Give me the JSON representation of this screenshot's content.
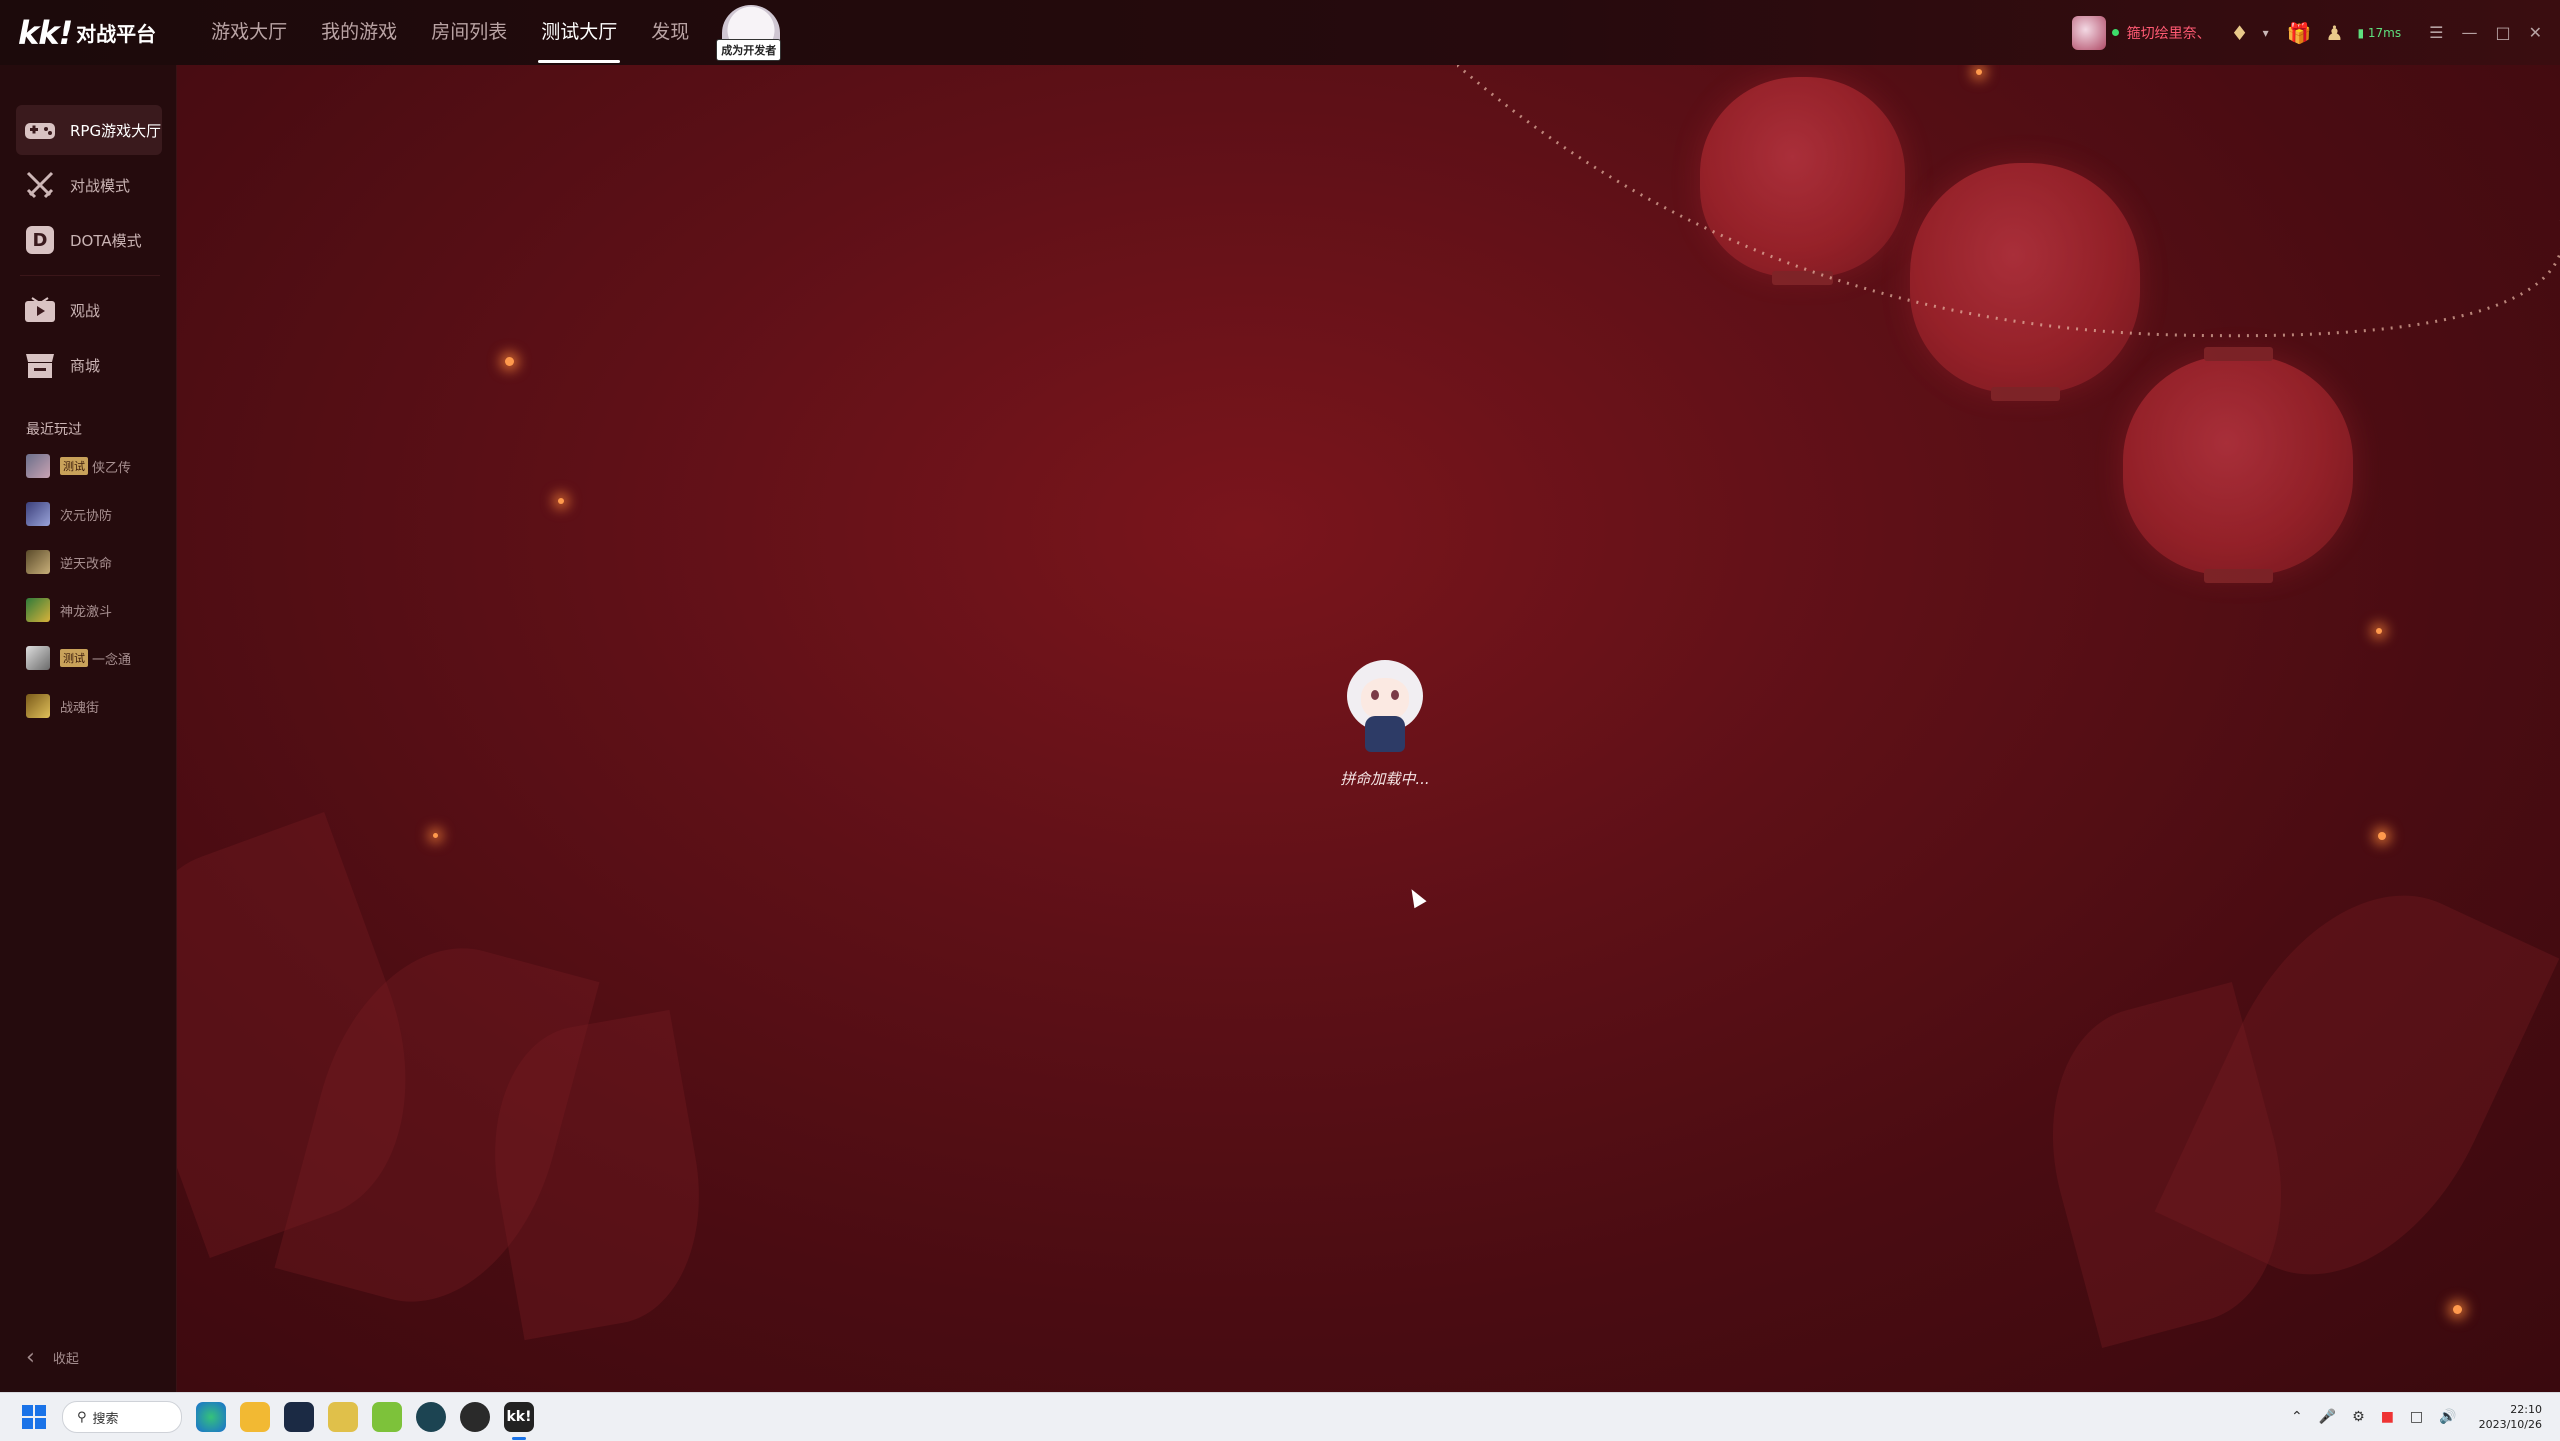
{
  "app": {
    "logo_mark": "kk!",
    "logo_name": "对战平台"
  },
  "nav": {
    "items": [
      {
        "label": "游戏大厅"
      },
      {
        "label": "我的游戏"
      },
      {
        "label": "房间列表"
      },
      {
        "label": "测试大厅"
      },
      {
        "label": "发现"
      }
    ],
    "active_index": 3,
    "dev_badge": "成为开发者"
  },
  "user": {
    "name": "箍切绘里奈、",
    "ping": "17ms",
    "colors": {
      "name": "#ff5a73",
      "online": "#3ddc6a",
      "ping": "#5ee07e"
    }
  },
  "sidebar": {
    "items": [
      {
        "label": "RPG游戏大厅",
        "icon": "gamepad-icon"
      },
      {
        "label": "对战模式",
        "icon": "crossed-swords-icon"
      },
      {
        "label": "DOTA模式",
        "icon": "dota-d-icon",
        "icon_glyph": "D"
      },
      {
        "label": "观战",
        "icon": "play-screen-icon"
      },
      {
        "label": "商城",
        "icon": "store-icon"
      }
    ],
    "recent_title": "最近玩过",
    "recent": [
      {
        "name": "侠乙传",
        "badge": "测试"
      },
      {
        "name": "次元协防",
        "badge": ""
      },
      {
        "name": "逆天改命",
        "badge": ""
      },
      {
        "name": "神龙激斗",
        "badge": ""
      },
      {
        "name": "一念通",
        "badge": "测试"
      },
      {
        "name": "战魂街",
        "badge": ""
      }
    ],
    "collapse_label": "收起"
  },
  "main": {
    "loading_text": "拼命加载中..."
  },
  "taskbar": {
    "search_label": "搜索",
    "apps": [
      "edge-icon",
      "file-explorer-icon",
      "steam-icon",
      "game-app-icon",
      "leaf-app-icon",
      "vpn-app-icon",
      "recorder-icon",
      "kk-icon"
    ],
    "kk_label": "kk!",
    "time": "22:10",
    "date": "2023/10/26"
  }
}
